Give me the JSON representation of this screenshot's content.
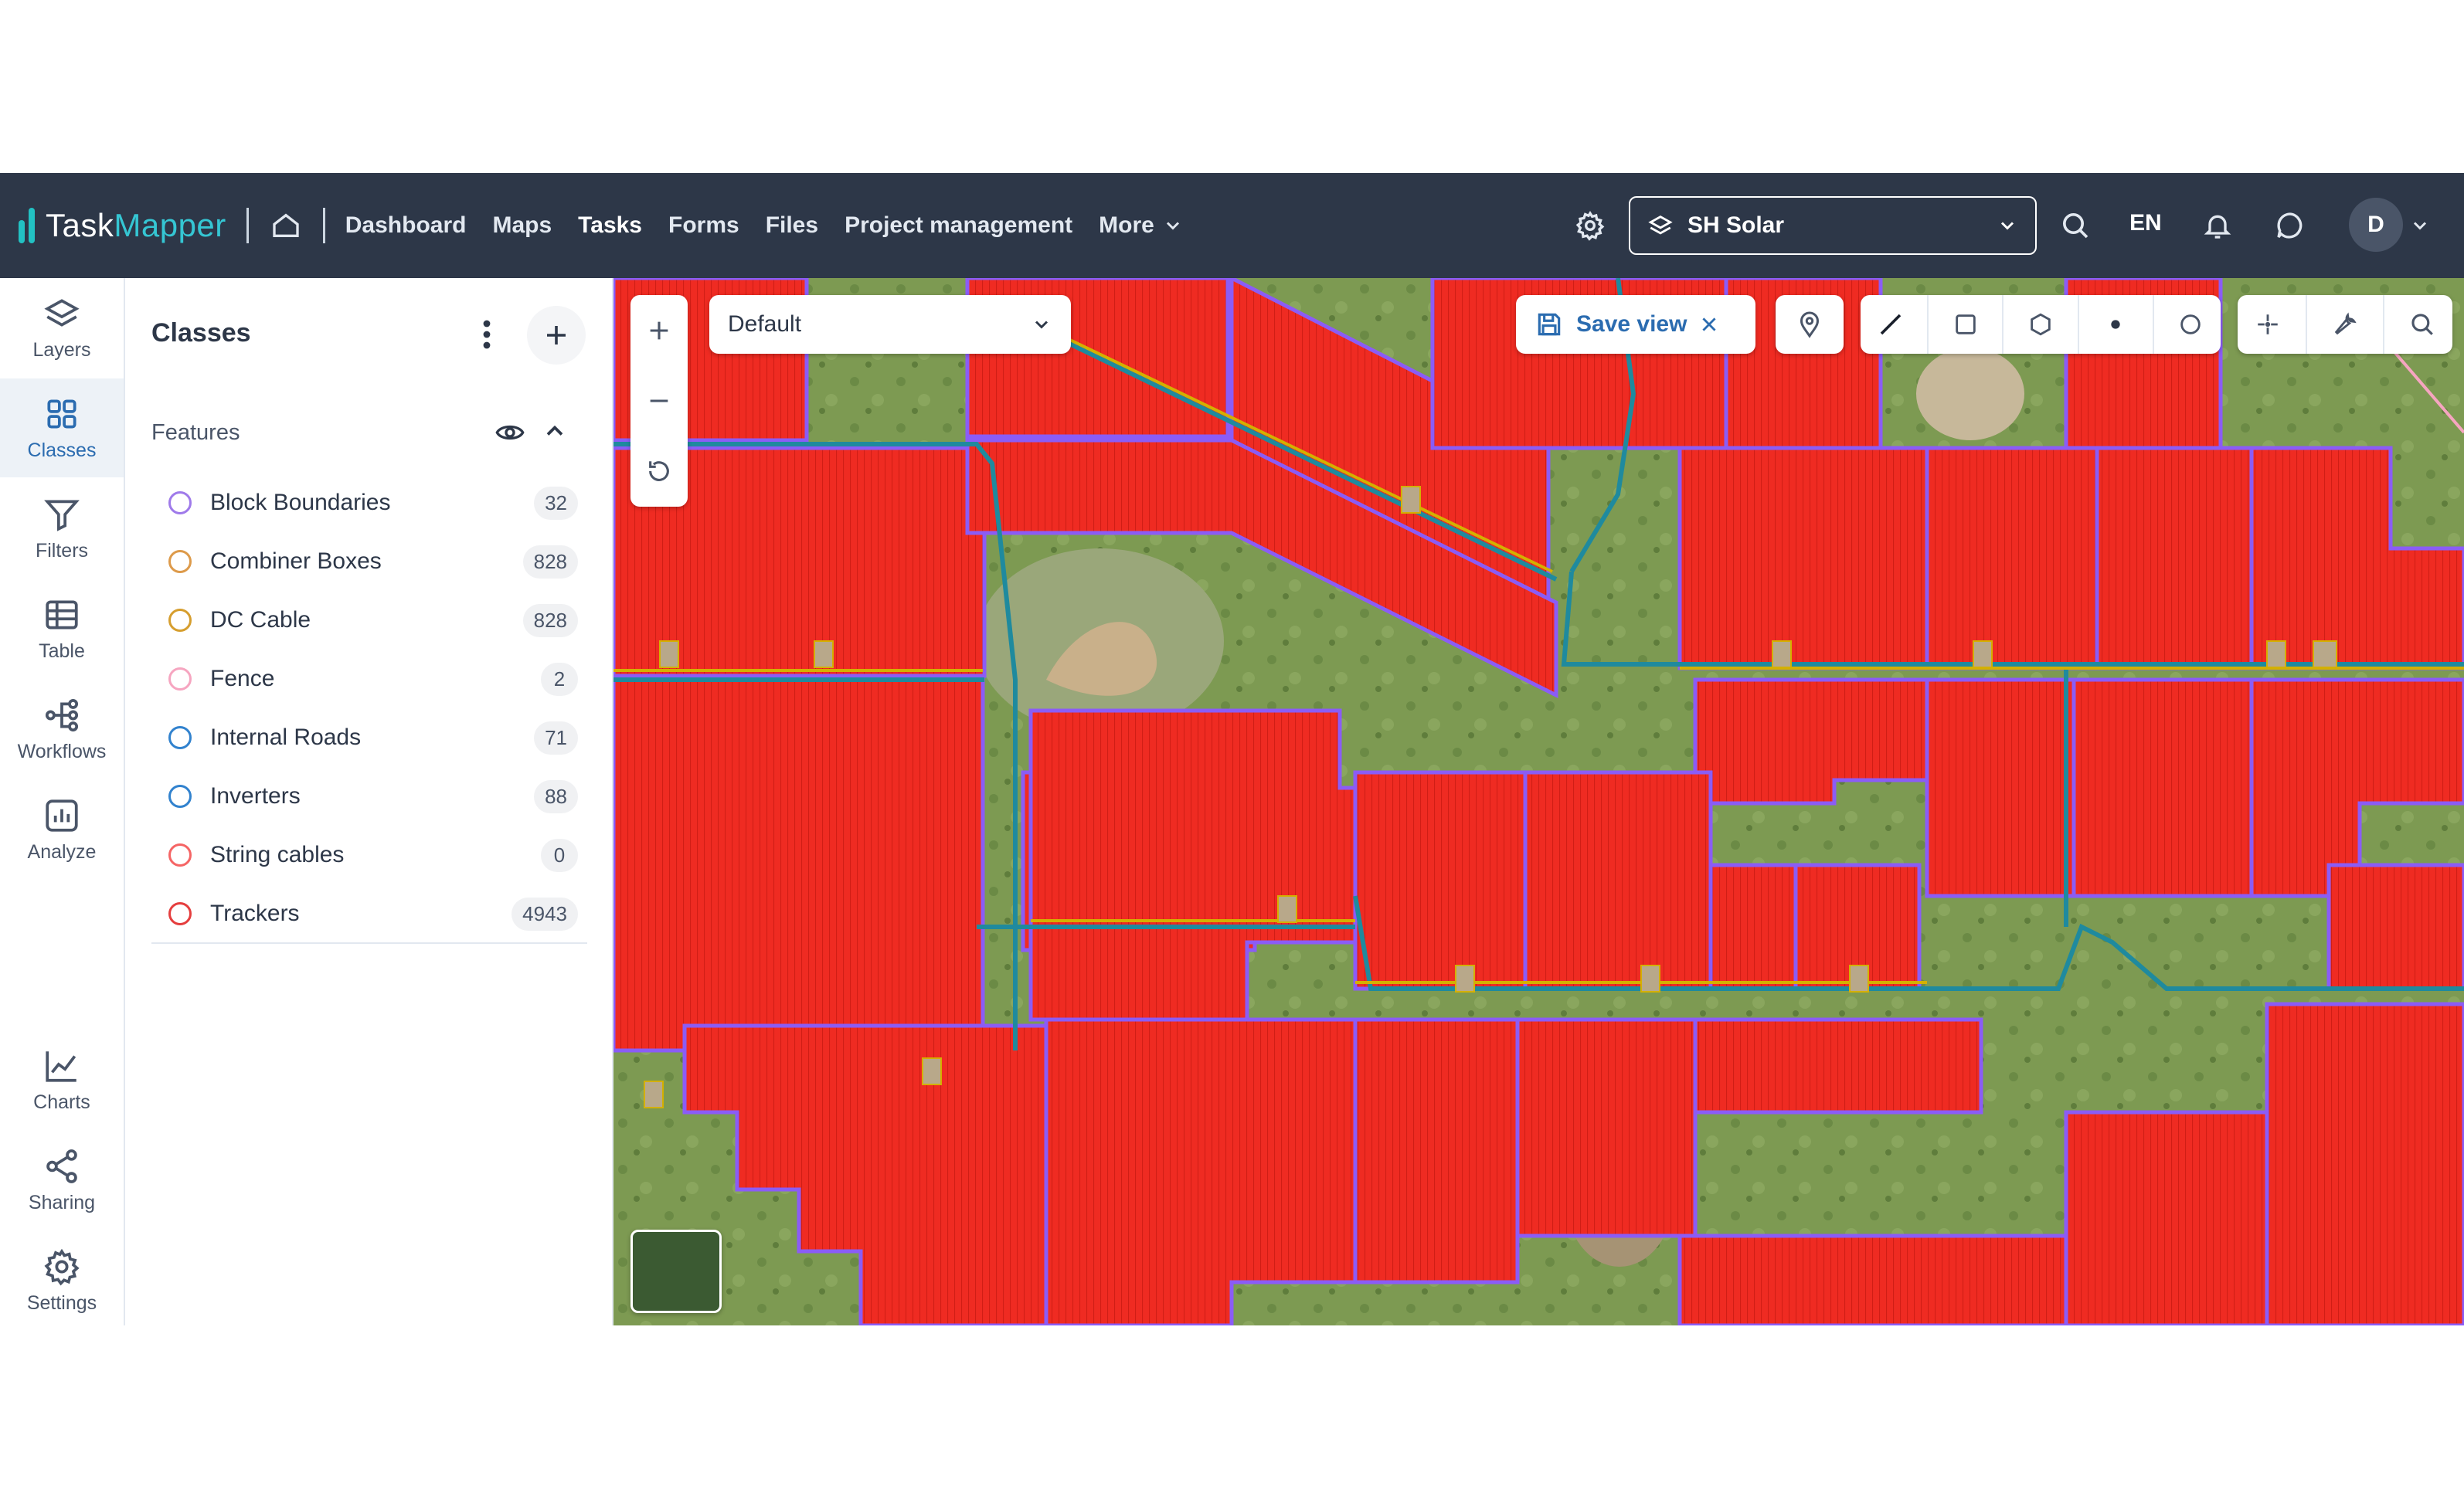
{
  "app": {
    "logo_part1": "Task",
    "logo_part2": "Mapper"
  },
  "nav": {
    "items": [
      "Dashboard",
      "Maps",
      "Tasks",
      "Forms",
      "Files",
      "Project management",
      "More"
    ],
    "active": "Tasks"
  },
  "project": {
    "name": "SH Solar"
  },
  "language": "EN",
  "user": {
    "initial": "D"
  },
  "rail": {
    "items": [
      "Layers",
      "Classes",
      "Filters",
      "Table",
      "Workflows",
      "Analyze",
      "Charts",
      "Sharing",
      "Settings"
    ],
    "active": "Classes"
  },
  "panel": {
    "title": "Classes",
    "section": "Features",
    "classes": [
      {
        "name": "Block Boundaries",
        "count": "32",
        "color": "#9f7aea"
      },
      {
        "name": "Combiner Boxes",
        "count": "828",
        "color": "#dd9a4a"
      },
      {
        "name": "DC Cable",
        "count": "828",
        "color": "#d69e2e"
      },
      {
        "name": "Fence",
        "count": "2",
        "color": "#f6a5c0"
      },
      {
        "name": "Internal Roads",
        "count": "71",
        "color": "#3182ce"
      },
      {
        "name": "Inverters",
        "count": "88",
        "color": "#3182ce"
      },
      {
        "name": "String cables",
        "count": "0",
        "color": "#f56565"
      },
      {
        "name": "Trackers",
        "count": "4943",
        "color": "#e53e3e"
      }
    ]
  },
  "map": {
    "view": "Default",
    "save_view": "Save view",
    "colors": {
      "tracker_fill": "#ef2b22",
      "block_border": "#8b5cf6",
      "road": "#1f8a9e",
      "cable": "#d4b000",
      "terrain": "#7f9a55"
    }
  },
  "colors": {
    "topbar": "#2d3748",
    "accent": "#2b6cb0",
    "logo_accent": "#35c6d3"
  }
}
